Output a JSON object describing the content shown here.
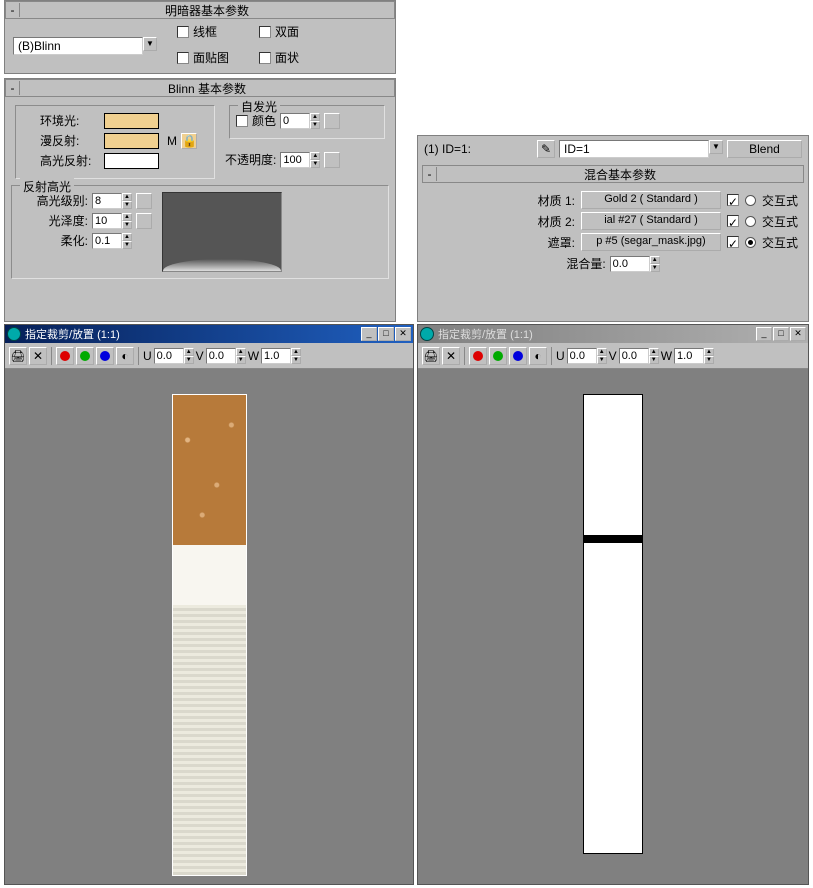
{
  "shader_panel": {
    "title": "明暗器基本参数",
    "shader_dropdown": "(B)Blinn",
    "check_wireframe": "线框",
    "check_twosided": "双面",
    "check_facemap": "面贴图",
    "check_faceted": "面状"
  },
  "blinn_panel": {
    "title": "Blinn 基本参数",
    "selfillum_title": "自发光",
    "color_label": "颜色",
    "selfillum_value": "0",
    "ambient_label": "环境光:",
    "diffuse_label": "漫反射:",
    "specular_label": "高光反射:",
    "M_label": "M",
    "opacity_label": "不透明度:",
    "opacity_value": "100",
    "spechl_title": "反射高光",
    "speclevel_label": "高光级别:",
    "speclevel_value": "8",
    "gloss_label": "光泽度:",
    "gloss_value": "10",
    "soften_label": "柔化:",
    "soften_value": "0.1"
  },
  "crop_a": {
    "title": "指定裁剪/放置 (1:1)",
    "u_label": "U",
    "u_value": "0.0",
    "v_label": "V",
    "v_value": "0.0",
    "w_label": "W",
    "w_value": "1.0"
  },
  "crop_b": {
    "title": "指定裁剪/放置 (1:1)",
    "u_label": "U",
    "u_value": "0.0",
    "v_label": "V",
    "v_value": "0.0",
    "w_label": "W",
    "w_value": "1.0"
  },
  "matedit": {
    "id_prefix": "(1) ID=1:",
    "id_dropdown": "ID=1",
    "blend_btn": "Blend",
    "mix_title": "混合基本参数",
    "mat1_label": "材质 1:",
    "mat1_btn": "Gold 2  ( Standard )",
    "mat2_label": "材质 2:",
    "mat2_btn": "ial #27  ( Standard )",
    "mask_label": "遮罩:",
    "mask_btn": "p #5 (segar_mask.jpg)",
    "interactive_label": "交互式",
    "mixamt_label": "混合量:",
    "mixamt_value": "0.0"
  }
}
